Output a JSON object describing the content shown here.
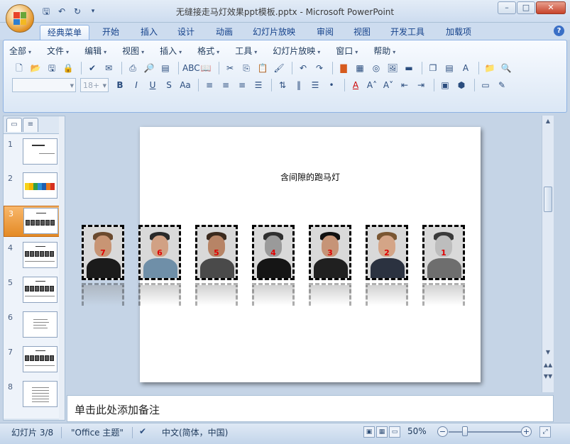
{
  "window": {
    "title": "无缝接走马灯效果ppt模板.pptx - Microsoft PowerPoint"
  },
  "qat": {
    "icons": [
      "save-icon",
      "undo-icon",
      "redo-icon",
      "customize-icon"
    ]
  },
  "tabs": [
    {
      "label": "经典菜单"
    },
    {
      "label": "开始"
    },
    {
      "label": "插入"
    },
    {
      "label": "设计"
    },
    {
      "label": "动画"
    },
    {
      "label": "幻灯片放映"
    },
    {
      "label": "审阅"
    },
    {
      "label": "视图"
    },
    {
      "label": "开发工具"
    },
    {
      "label": "加载项"
    }
  ],
  "menu": [
    {
      "label": "全部"
    },
    {
      "label": "文件"
    },
    {
      "label": "编辑"
    },
    {
      "label": "视图"
    },
    {
      "label": "插入"
    },
    {
      "label": "格式"
    },
    {
      "label": "工具"
    },
    {
      "label": "幻灯片放映"
    },
    {
      "label": "窗口"
    },
    {
      "label": "帮助"
    }
  ],
  "font": {
    "name_value": "",
    "size_value": "18+"
  },
  "slides": [
    {
      "num": "1"
    },
    {
      "num": "2"
    },
    {
      "num": "3"
    },
    {
      "num": "4"
    },
    {
      "num": "5"
    },
    {
      "num": "6"
    },
    {
      "num": "7"
    },
    {
      "num": "8"
    }
  ],
  "current_slide": {
    "title": "含间隙的跑马灯",
    "photos": [
      {
        "label": "7"
      },
      {
        "label": "6"
      },
      {
        "label": "5"
      },
      {
        "label": "4"
      },
      {
        "label": "3"
      },
      {
        "label": "2"
      },
      {
        "label": "1"
      }
    ]
  },
  "notes": {
    "placeholder": "单击此处添加备注"
  },
  "status": {
    "slide_info": "幻灯片 3/8",
    "theme": "\"Office 主题\"",
    "language": "中文(简体，中国)",
    "zoom": "50%"
  }
}
